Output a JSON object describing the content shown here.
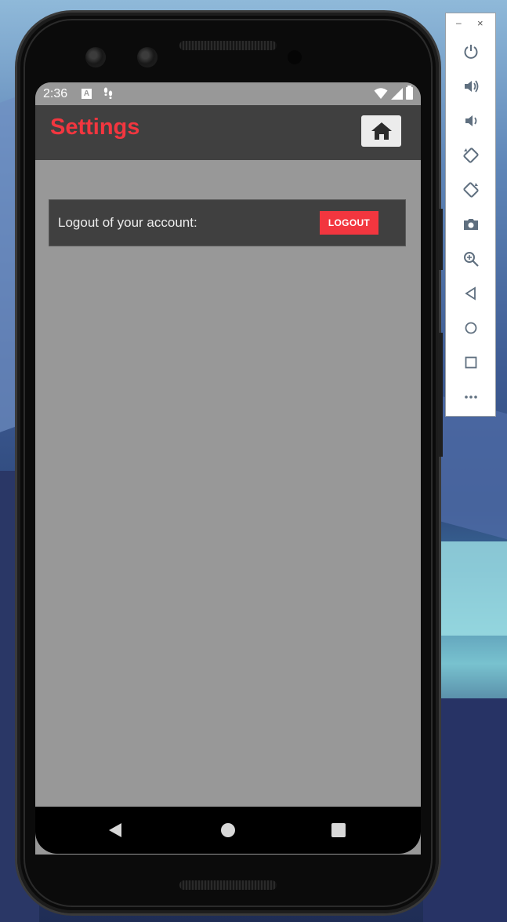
{
  "status_bar": {
    "time": "2:36",
    "notification_a": "A"
  },
  "app_bar": {
    "title": "Settings",
    "home_icon": "home-icon"
  },
  "logout_row": {
    "label": "Logout of your account:",
    "button_label": "LOGOUT"
  },
  "nav_bar": {
    "back_icon": "back-triangle-icon",
    "home_icon": "home-circle-icon",
    "recent_icon": "recents-square-icon"
  },
  "emulator_toolbar": {
    "minimize": "–",
    "close": "×",
    "items": [
      "power-icon",
      "volume-up-icon",
      "volume-down-icon",
      "rotate-left-icon",
      "rotate-right-icon",
      "camera-icon",
      "zoom-icon",
      "back-icon",
      "home-icon",
      "overview-icon",
      "more-icon"
    ]
  },
  "colors": {
    "accent": "#f2363f",
    "app_bar": "#404040",
    "screen_bg": "#989898",
    "home_button_bg": "#ececec"
  }
}
